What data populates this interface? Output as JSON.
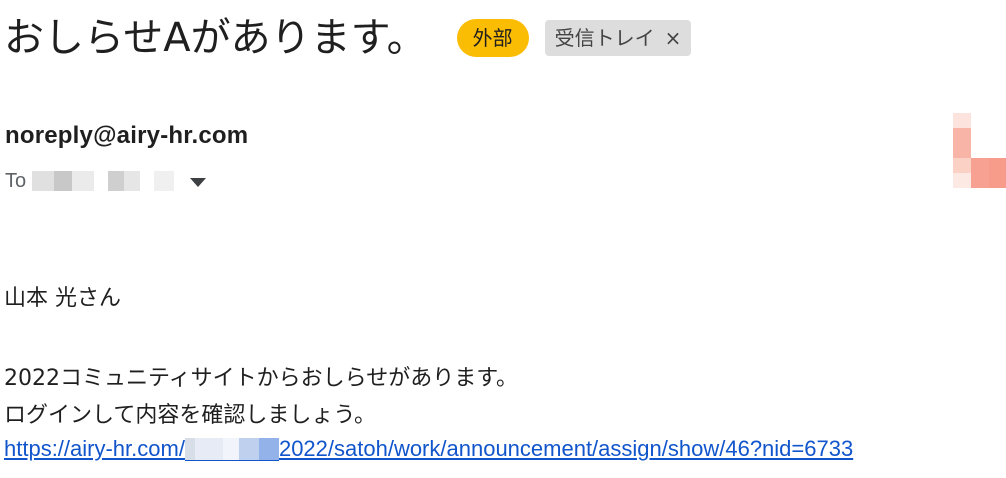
{
  "header": {
    "subject": "おしらせAがあります。",
    "label_external": "外部",
    "label_inbox": "受信トレイ",
    "label_inbox_remove": "×"
  },
  "sender": {
    "email": "noreply@airy-hr.com",
    "to_label": "To"
  },
  "colors": {
    "external_badge": "#fbbc04",
    "inbox_badge": "#dddddd",
    "link": "#1155cc"
  },
  "body": {
    "greeting": "山本 光さん",
    "line1": "2022コミュニティサイトからおしらせがあります。",
    "line2": "ログインして内容を確認しましょう。",
    "link_prefix": "https://airy-hr.com/",
    "link_suffix": "2022/satoh/work/announcement/assign/show/46?nid=6733"
  }
}
